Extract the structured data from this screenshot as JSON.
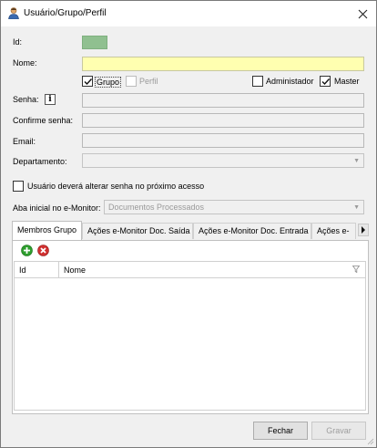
{
  "window": {
    "title": "Usuário/Grupo/Perfil"
  },
  "form": {
    "id_label": "Id:",
    "nome_label": "Nome:",
    "nome_value": "",
    "grupo_label": "Grupo",
    "grupo_checked": true,
    "perfil_label": "Perfil",
    "perfil_checked": false,
    "admin_label": "Administador",
    "admin_checked": false,
    "master_label": "Master",
    "master_checked": true,
    "senha_label": "Senha:",
    "info_glyph": "i",
    "confirme_label": "Confirme senha:",
    "email_label": "Email:",
    "departamento_label": "Departamento:",
    "alterar_senha_label": "Usuário deverá alterar senha no próximo acesso",
    "alterar_senha_checked": false,
    "aba_label": "Aba inicial no e-Monitor:",
    "aba_value": "Documentos Processados"
  },
  "tabs": [
    {
      "label": "Membros Grupo",
      "active": true
    },
    {
      "label": "Ações e-Monitor Doc. Saída",
      "active": false
    },
    {
      "label": "Ações e-Monitor Doc. Entrada",
      "active": false
    },
    {
      "label": "Ações e-",
      "active": false
    }
  ],
  "grid": {
    "columns": [
      "Id",
      "Nome"
    ]
  },
  "buttons": {
    "fechar": "Fechar",
    "gravar": "Gravar"
  },
  "colors": {
    "id_swatch": "#90c090",
    "name_field_bg": "#ffffb0",
    "add_icon": "#2e9e2e",
    "remove_icon": "#d03030"
  }
}
